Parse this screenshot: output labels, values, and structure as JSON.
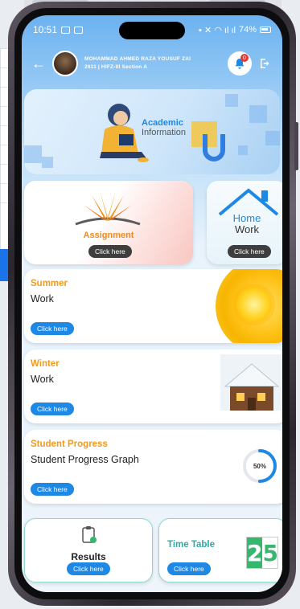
{
  "status_bar": {
    "time": "10:51",
    "battery": "74%"
  },
  "header": {
    "student_name": "MOHAMMAD AHMED RAZA YOUSUF ZAI",
    "student_meta": "2611 | HIFZ-III Section A",
    "notification_count": "0"
  },
  "banner": {
    "title_line1": "Academic",
    "title_line2": "Information"
  },
  "assignment": {
    "label": "Assignment",
    "button": "Click here"
  },
  "homework": {
    "label_line1": "Home",
    "label_line2": "Work",
    "button": "Click here"
  },
  "summer": {
    "title": "Summer",
    "subtitle": "Work",
    "button": "Click here"
  },
  "winter": {
    "title": "Winter",
    "subtitle": "Work",
    "button": "Click here"
  },
  "progress": {
    "title": "Student Progress",
    "subtitle": "Student Progress Graph",
    "button": "Click here",
    "percent_label": "50%",
    "percent_value": 50
  },
  "results": {
    "label": "Results",
    "button": "Click here"
  },
  "timetable": {
    "label": "Time Table",
    "button": "Click here",
    "cal_digit1": "2",
    "cal_digit2": "5"
  },
  "colors": {
    "accent_blue": "#1e88e5",
    "accent_orange": "#f29a1e",
    "teal": "#2fa9a8",
    "green": "#35b86d"
  }
}
